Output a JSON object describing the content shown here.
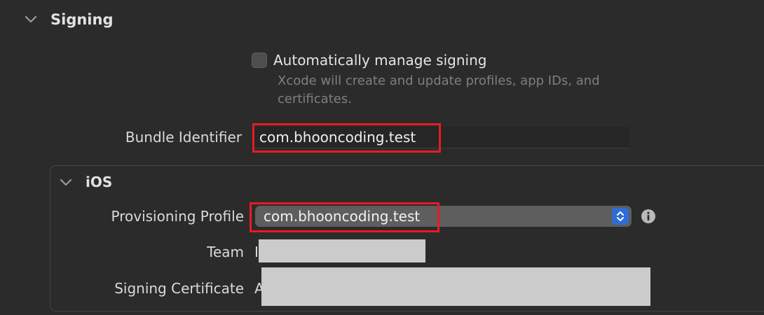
{
  "signing": {
    "section_title": "Signing",
    "auto_manage": {
      "label": "Automatically manage signing",
      "description": "Xcode will create and update profiles, app IDs, and certificates.",
      "checked": false
    },
    "bundle_identifier": {
      "label": "Bundle Identifier",
      "value": "com.bhooncoding.test"
    }
  },
  "ios": {
    "title": "iOS",
    "provisioning_profile": {
      "label": "Provisioning Profile",
      "value": "com.bhooncoding.test",
      "stepper_icon": "chevron-up-down-icon",
      "info_icon": "info-icon"
    },
    "team": {
      "label": "Team",
      "partial_value": "I"
    },
    "signing_certificate": {
      "label": "Signing Certificate",
      "partial_value": "A"
    }
  },
  "colors": {
    "background": "#2b2b2b",
    "highlight": "#e51c24",
    "stepper_accent": "#2d6dd8",
    "redaction": "#cbcbcb"
  }
}
